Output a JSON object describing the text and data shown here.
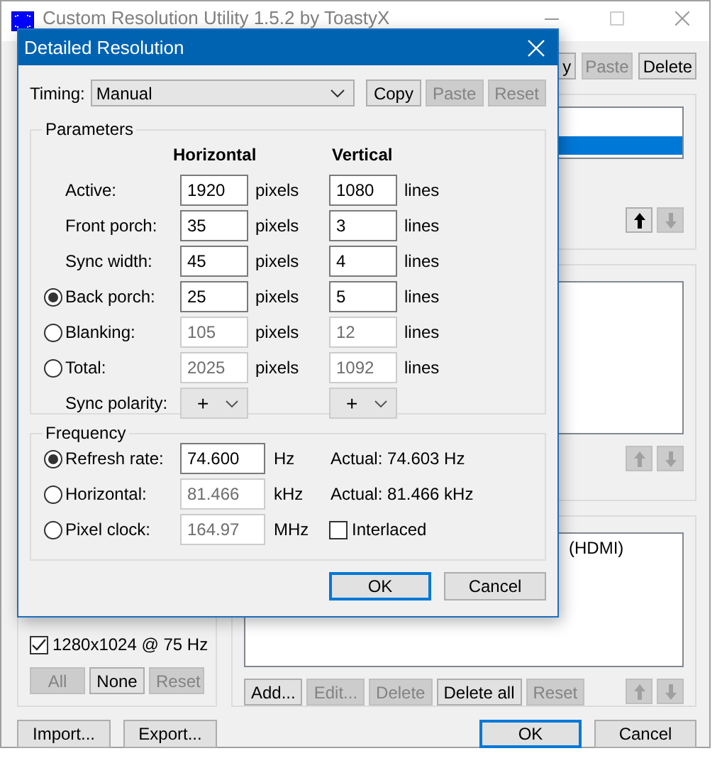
{
  "main_window": {
    "title": "Custom Resolution Utility 1.5.2 by ToastyX",
    "toolbar_buttons": [
      {
        "label": "y",
        "disabled": false
      },
      {
        "label": "Paste",
        "disabled": true
      },
      {
        "label": "Delete",
        "disabled": false
      }
    ],
    "top_list": {
      "rows": [
        {
          "selected": true
        }
      ],
      "arrows": [
        {
          "kind": "up",
          "disabled": false
        },
        {
          "kind": "down",
          "disabled": true
        }
      ]
    },
    "middle_list": {
      "arrows": [
        {
          "kind": "up",
          "disabled": true
        },
        {
          "kind": "down",
          "disabled": true
        }
      ]
    },
    "extension_list": {
      "rows": [
        {
          "label": "(HDMI)"
        }
      ],
      "buttons": [
        {
          "label": "Add...",
          "disabled": false
        },
        {
          "label": "Edit...",
          "disabled": true
        },
        {
          "label": "Delete",
          "disabled": true
        },
        {
          "label": "Delete all",
          "disabled": false
        },
        {
          "label": "Reset",
          "disabled": true
        }
      ],
      "arrows": [
        {
          "kind": "up",
          "disabled": true
        },
        {
          "kind": "down",
          "disabled": true
        }
      ]
    },
    "resolution_checkbox": {
      "label": "1280x1024 @ 75 Hz",
      "checked": true
    },
    "select_buttons": [
      {
        "label": "All",
        "disabled": true
      },
      {
        "label": "None",
        "disabled": false
      },
      {
        "label": "Reset",
        "disabled": true
      }
    ],
    "footer_buttons": [
      {
        "label": "Import...",
        "default": false
      },
      {
        "label": "Export...",
        "default": false
      },
      {
        "label": "OK",
        "default": true
      },
      {
        "label": "Cancel",
        "default": false
      }
    ]
  },
  "dialog": {
    "title": "Detailed Resolution",
    "timing": {
      "label": "Timing:",
      "value": "Manual"
    },
    "timing_buttons": [
      {
        "label": "Copy",
        "disabled": false
      },
      {
        "label": "Paste",
        "disabled": true
      },
      {
        "label": "Reset",
        "disabled": true
      }
    ],
    "parameters": {
      "title": "Parameters",
      "headings": [
        "Horizontal",
        "Vertical"
      ],
      "rows": [
        {
          "kind": "plain",
          "label": "Active:",
          "h": "1920",
          "h_unit": "pixels",
          "v": "1080",
          "v_unit": "lines",
          "disabled": false
        },
        {
          "kind": "plain",
          "label": "Front porch:",
          "h": "35",
          "h_unit": "pixels",
          "v": "3",
          "v_unit": "lines",
          "disabled": false
        },
        {
          "kind": "plain",
          "label": "Sync width:",
          "h": "45",
          "h_unit": "pixels",
          "v": "4",
          "v_unit": "lines",
          "disabled": false
        },
        {
          "kind": "radio",
          "selected": true,
          "label": "Back porch:",
          "h": "25",
          "h_unit": "pixels",
          "v": "5",
          "v_unit": "lines",
          "disabled": false
        },
        {
          "kind": "radio",
          "selected": false,
          "label": "Blanking:",
          "h": "105",
          "h_unit": "pixels",
          "v": "12",
          "v_unit": "lines",
          "disabled": true
        },
        {
          "kind": "radio",
          "selected": false,
          "label": "Total:",
          "h": "2025",
          "h_unit": "pixels",
          "v": "1092",
          "v_unit": "lines",
          "disabled": true
        }
      ],
      "polarity": {
        "label": "Sync polarity:",
        "h": "+",
        "v": "+"
      }
    },
    "frequency": {
      "title": "Frequency",
      "rows": [
        {
          "label": "Refresh rate:",
          "value": "74.600",
          "unit": "Hz",
          "selected": true,
          "disabled": false,
          "actual": "Actual: 74.603 Hz"
        },
        {
          "label": "Horizontal:",
          "value": "81.466",
          "unit": "kHz",
          "selected": false,
          "disabled": true,
          "actual": "Actual: 81.466 kHz"
        },
        {
          "label": "Pixel clock:",
          "value": "164.97",
          "unit": "MHz",
          "selected": false,
          "disabled": true
        }
      ],
      "interlaced": {
        "label": "Interlaced",
        "checked": false
      }
    },
    "buttons": [
      {
        "label": "OK",
        "default": true
      },
      {
        "label": "Cancel",
        "default": false
      }
    ]
  }
}
